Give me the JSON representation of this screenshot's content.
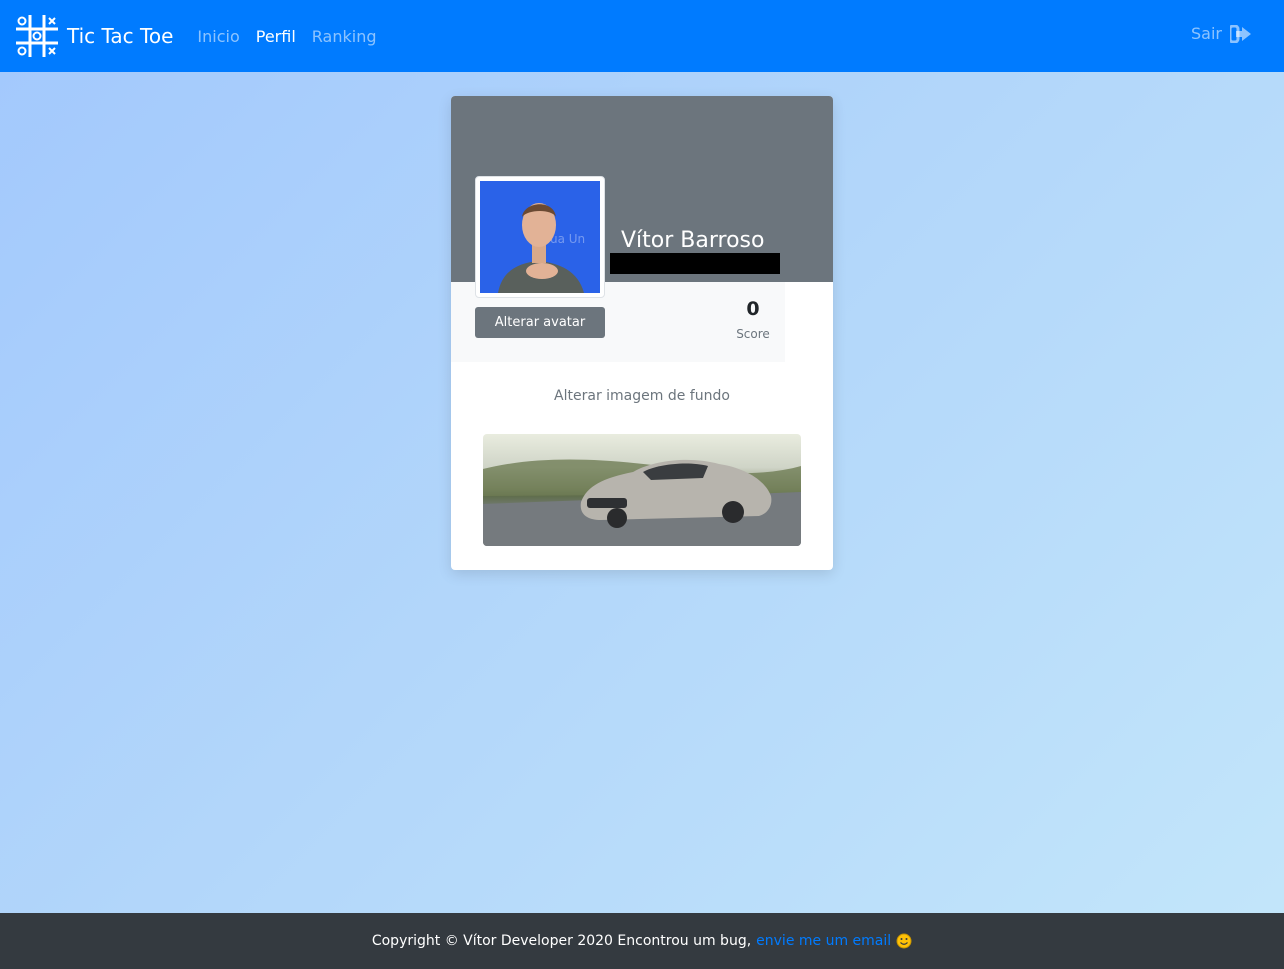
{
  "navbar": {
    "brand": "Tic Tac Toe",
    "links": [
      {
        "label": "Inicio",
        "active": false
      },
      {
        "label": "Perfil",
        "active": true
      },
      {
        "label": "Ranking",
        "active": false
      }
    ],
    "logout_label": "Sair",
    "logout_icon": "sign-out-icon",
    "brand_icon": "tic-tac-toe-grid-icon",
    "color": "#007bff"
  },
  "profile": {
    "name": "Vítor Barroso",
    "change_avatar_label": "Alterar avatar",
    "score_value": "0",
    "score_label": "Score",
    "change_background_label": "Alterar imagem de fundo",
    "cover_color": "#6c757d"
  },
  "footer": {
    "text": "Copyright © Vítor Developer 2020 Encontrou um bug,",
    "link_text": "envie me um email",
    "emoji_icon": "smiley-face-icon",
    "background": "#343a40"
  }
}
